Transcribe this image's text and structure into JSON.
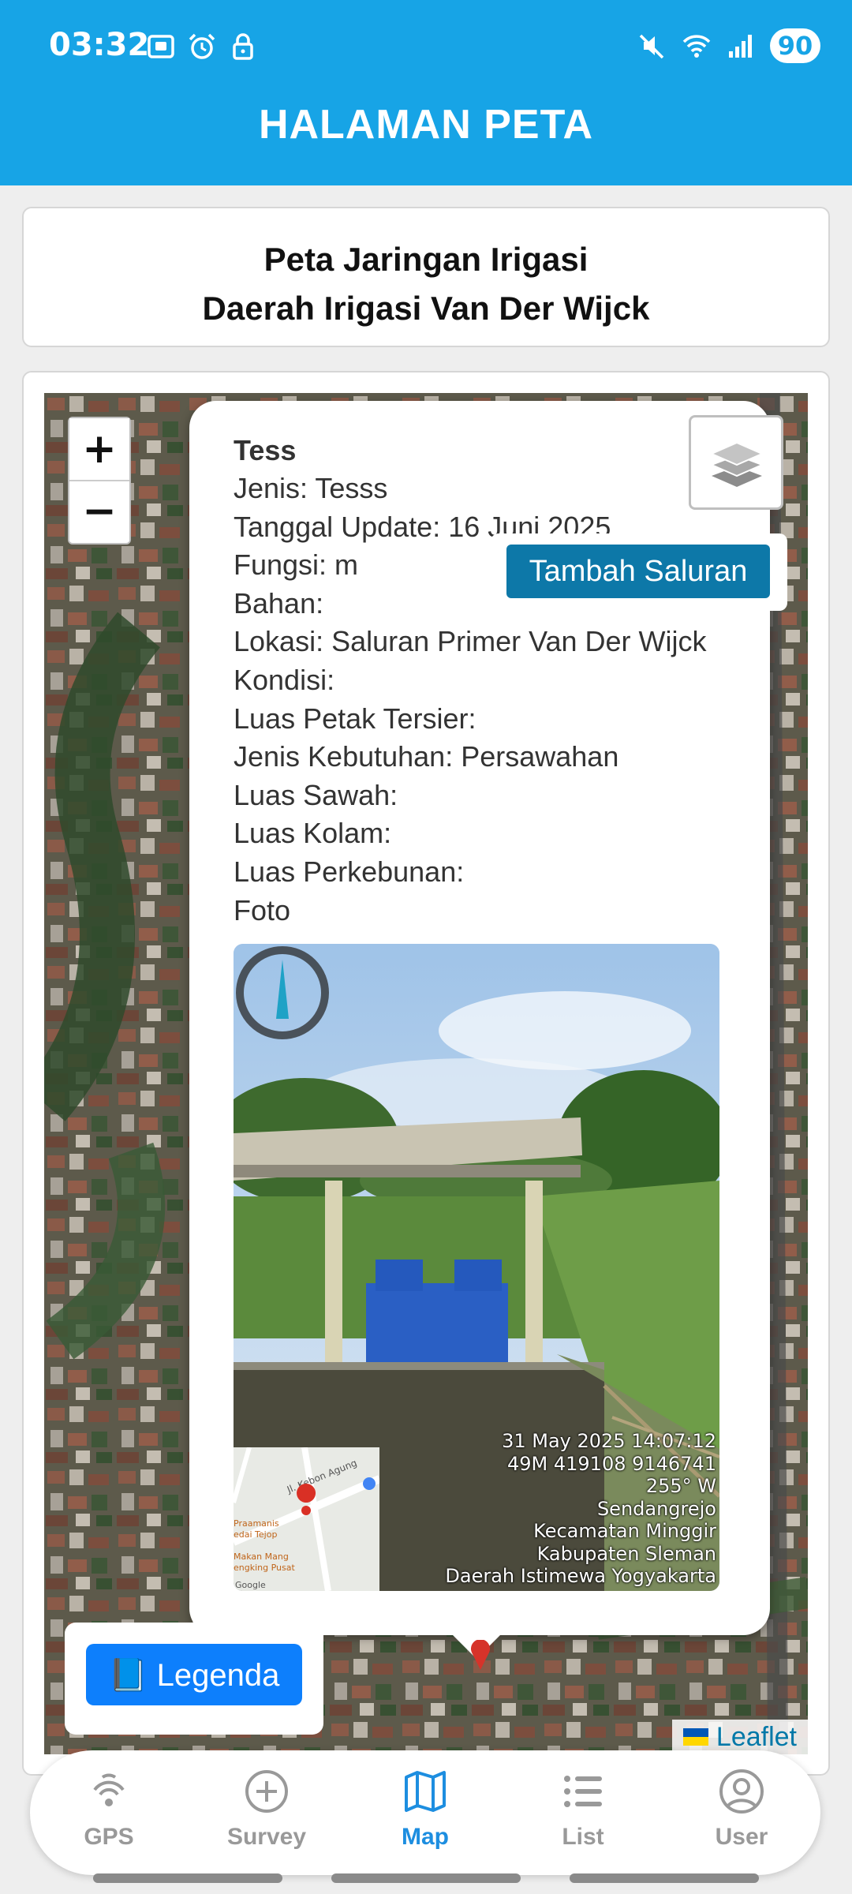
{
  "status_bar": {
    "time": "03:32",
    "left_icons": [
      "screenshot-icon",
      "alarm-icon",
      "lock-icon"
    ],
    "right_icons": [
      "mute-icon",
      "wifi-icon",
      "signal-icon"
    ],
    "battery": "90"
  },
  "app_bar": {
    "title": "HALAMAN PETA",
    "color": "#17a4e6"
  },
  "heading": {
    "line1": "Peta Jaringan Irigasi",
    "line2": "Daerah Irigasi Van Der Wijck"
  },
  "map": {
    "zoom_in": "+",
    "zoom_out": "−",
    "layers_icon": "layers-icon",
    "tambah_button": "Tambah Saluran",
    "legend_button": "📘 Legenda",
    "attribution": "Leaflet",
    "popup": {
      "name": "Tess",
      "rows": [
        "Jenis: Tesss",
        "Tanggal Update: 16 Juni 2025",
        "Fungsi: m",
        "Bahan:",
        "Lokasi: Saluran Primer Van Der Wijck",
        "Kondisi:",
        "Luas Petak Tersier:",
        "Jenis Kebutuhan: Persawahan",
        "Luas Sawah:",
        "Luas Kolam:",
        "Luas Perkebunan:",
        "Foto"
      ],
      "photo_stamp": [
        "31 May 2025 14:07:12",
        "49M 419108 9146741",
        "255° W",
        "Sendangrejo",
        "Kecamatan Minggir",
        "Kabupaten Sleman",
        "Daerah Istimewa Yogyakarta"
      ],
      "photo_compass": "compass-icon",
      "minimap_labels": {
        "road": "Jl. Kebon Agung",
        "place1": "Praamanis",
        "place2": "edai Tejop",
        "place3": "Makan Mang",
        "place4": "engking Pusat",
        "brand": "Google"
      }
    }
  },
  "bottom_nav": {
    "items": [
      {
        "label": "GPS",
        "icon": "gps-icon"
      },
      {
        "label": "Survey",
        "icon": "add-circle-icon"
      },
      {
        "label": "Map",
        "icon": "map-icon"
      },
      {
        "label": "List",
        "icon": "list-icon"
      },
      {
        "label": "User",
        "icon": "user-icon"
      }
    ],
    "active": "Map",
    "active_color": "#1d8ee0"
  }
}
